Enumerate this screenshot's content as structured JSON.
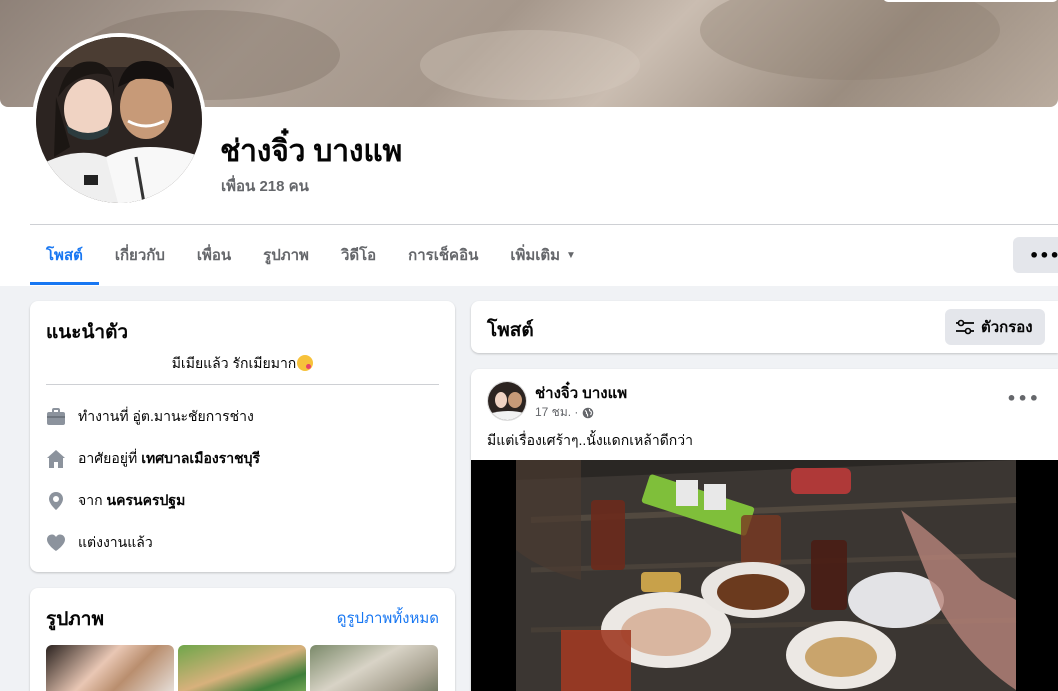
{
  "profile": {
    "name": "ช่างจิ๋ว บางแพ",
    "friends": "เพื่อน 218 คน"
  },
  "tabs": [
    {
      "label": "โพสต์",
      "active": true
    },
    {
      "label": "เกี่ยวกับ",
      "active": false
    },
    {
      "label": "เพื่อน",
      "active": false
    },
    {
      "label": "รูปภาพ",
      "active": false
    },
    {
      "label": "วิดีโอ",
      "active": false
    },
    {
      "label": "การเช็คอิน",
      "active": false
    },
    {
      "label": "เพิ่มเติม",
      "active": false,
      "has_caret": true
    }
  ],
  "more_button": "•••",
  "intro": {
    "title": "แนะนำตัว",
    "bio": "มีเมียแล้ว รักเมียมาก",
    "rows": [
      {
        "icon": "briefcase-icon",
        "text": "ทำงานที่ อู่ต.มานะชัยการช่าง",
        "bold": ""
      },
      {
        "icon": "home-icon",
        "text": "อาศัยอยู่ที่",
        "bold": "เทศบาลเมืองราชบุรี"
      },
      {
        "icon": "location-pin-icon",
        "text": "จาก",
        "bold": "นครนครปฐม"
      },
      {
        "icon": "heart-icon",
        "text": "แต่งงานแล้ว",
        "bold": ""
      }
    ]
  },
  "photos": {
    "title": "รูปภาพ",
    "see_all": "ดูรูปภาพทั้งหมด"
  },
  "posts": {
    "title": "โพสต์",
    "filter_label": "ตัวกรอง"
  },
  "post": {
    "author": "ช่างจิ๋ว บางแพ",
    "time": "17 ชม. ·",
    "text": "มีแต่เรื่องเศร้าๆ..นั้งแดกเหล้าดีกว่า",
    "dots": "•••"
  },
  "colors": {
    "accent": "#1877f2",
    "secondary_text": "#65676b",
    "background": "#f0f2f5"
  }
}
